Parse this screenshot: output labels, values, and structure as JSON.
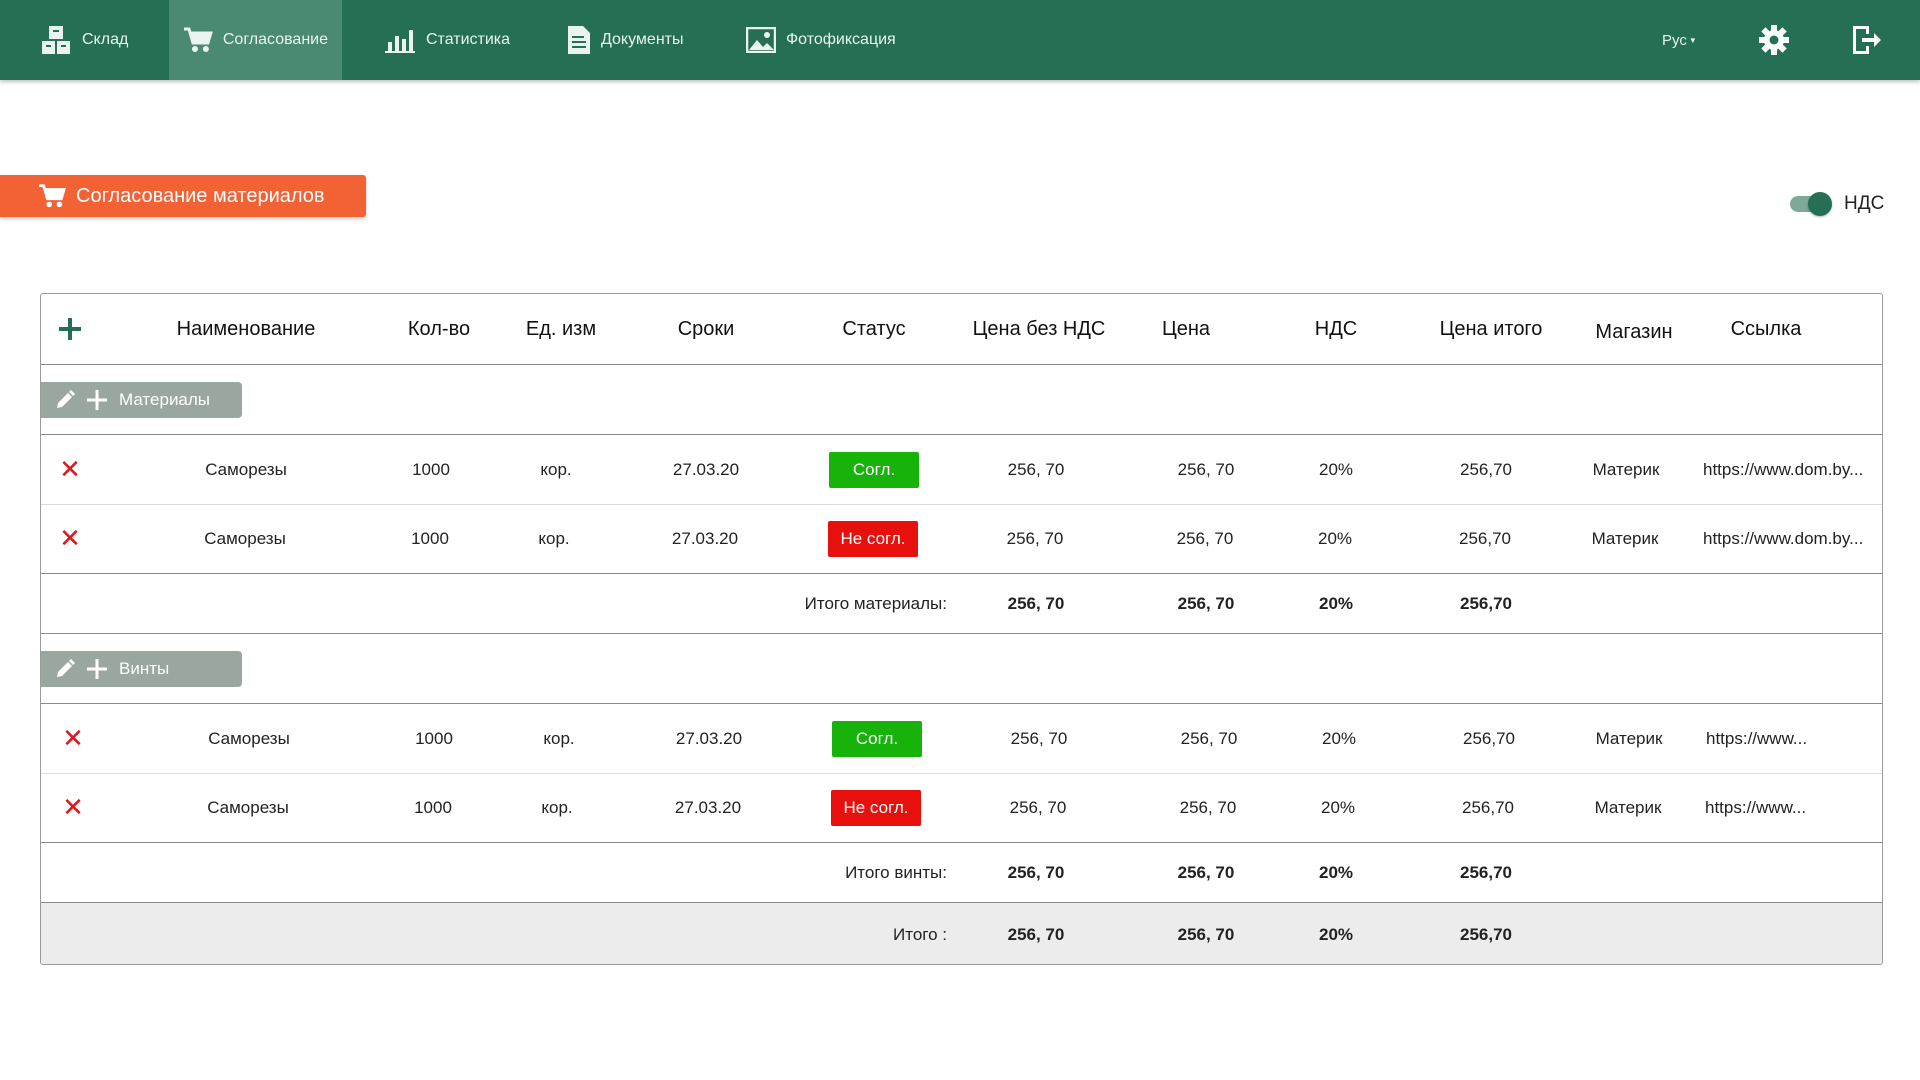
{
  "nav": {
    "items": [
      {
        "label": "Склад",
        "icon": "warehouse-icon"
      },
      {
        "label": "Согласование",
        "icon": "cart-icon",
        "active": true
      },
      {
        "label": "Статистика",
        "icon": "bar-chart-icon"
      },
      {
        "label": "Документы",
        "icon": "document-icon"
      },
      {
        "label": "Фотофиксация",
        "icon": "image-icon"
      }
    ],
    "language": "Рус",
    "settings_icon": "gear-icon",
    "logout_icon": "logout-icon",
    "bg_color": "#256f55"
  },
  "page": {
    "title": "Согласование материалов",
    "title_color": "#f26235",
    "vat_label": "НДС",
    "vat_enabled": true
  },
  "table": {
    "columns": [
      "Наименование",
      "Кол-во",
      "Ед. изм",
      "Сроки",
      "Статус",
      "Цена без НДС",
      "Цена",
      "НДС",
      "Цена итого",
      "Магазин",
      "Ссылка"
    ],
    "groups": [
      {
        "name": "Материалы",
        "rows": [
          {
            "name": "Саморезы",
            "qty": "1000",
            "unit": "кор.",
            "date": "27.03.20",
            "status": "Согл.",
            "status_type": "ok",
            "price_no_vat": "256, 70",
            "price": "256, 70",
            "vat": "20%",
            "total": "256,70",
            "shop": "Материк",
            "link": "https://www.dom.by..."
          },
          {
            "name": "Саморезы",
            "qty": "1000",
            "unit": "кор.",
            "date": "27.03.20",
            "status": "Не согл.",
            "status_type": "no",
            "price_no_vat": "256, 70",
            "price": "256, 70",
            "vat": "20%",
            "total": "256,70",
            "shop": "Материк",
            "link": "https://www.dom.by..."
          }
        ],
        "subtotal": {
          "label": "Итого материалы:",
          "price_no_vat": "256, 70",
          "price": "256, 70",
          "vat": "20%",
          "total": "256,70"
        }
      },
      {
        "name": "Винты",
        "rows": [
          {
            "name": "Саморезы",
            "qty": "1000",
            "unit": "кор.",
            "date": "27.03.20",
            "status": "Согл.",
            "status_type": "ok",
            "price_no_vat": "256, 70",
            "price": "256, 70",
            "vat": "20%",
            "total": "256,70",
            "shop": "Материк",
            "link": "https://www..."
          },
          {
            "name": "Саморезы",
            "qty": "1000",
            "unit": "кор.",
            "date": "27.03.20",
            "status": "Не согл.",
            "status_type": "no",
            "price_no_vat": "256, 70",
            "price": "256, 70",
            "vat": "20%",
            "total": "256,70",
            "shop": "Материк",
            "link": "https://www..."
          }
        ],
        "subtotal": {
          "label": "Итого винты:",
          "price_no_vat": "256, 70",
          "price": "256, 70",
          "vat": "20%",
          "total": "256,70"
        }
      }
    ],
    "grand_total": {
      "label": "Итого :",
      "price_no_vat": "256, 70",
      "price": "256, 70",
      "vat": "20%",
      "total": "256,70"
    }
  }
}
